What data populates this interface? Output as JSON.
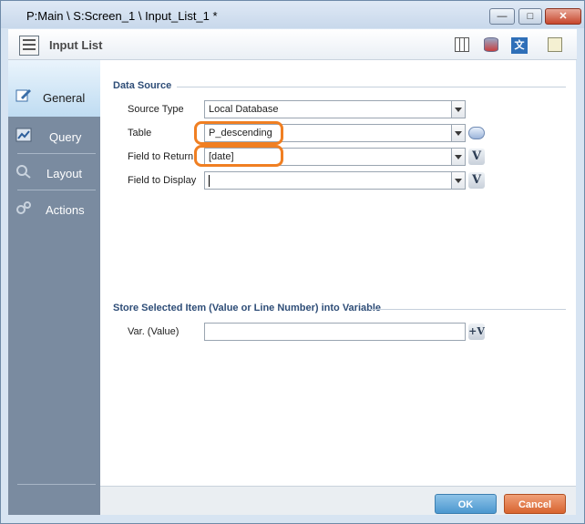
{
  "window": {
    "title": "P:Main \\ S:Screen_1 \\ Input_List_1 *",
    "min_glyph": "—",
    "max_glyph": "□",
    "close_glyph": "✕"
  },
  "toolbar": {
    "title": "Input List",
    "lang_glyph": "文"
  },
  "sidebar": {
    "items": [
      {
        "label": "General",
        "active": true,
        "icon": "pencil-icon"
      },
      {
        "label": "Query",
        "active": false,
        "icon": "chart-icon"
      },
      {
        "label": "Layout",
        "active": false,
        "icon": "magnifier-icon"
      },
      {
        "label": "Actions",
        "active": false,
        "icon": "gears-icon"
      }
    ]
  },
  "data_source": {
    "section_title": "Data Source",
    "source_type_label": "Source Type",
    "source_type_value": "Local Database",
    "table_label": "Table",
    "table_value": "P_descending",
    "field_return_label": "Field to Return",
    "field_return_value": "[date]",
    "field_display_label": "Field to Display",
    "field_display_value": "",
    "v_glyph": "V"
  },
  "store": {
    "section_title": "Store Selected Item (Value or Line Number) into Variable",
    "var_label": "Var. (Value)",
    "var_value": "",
    "v_glyph": "+V"
  },
  "footer": {
    "ok_label": "OK",
    "cancel_label": "Cancel"
  },
  "colors": {
    "highlight": "#f07f22",
    "ok_button": "#4b97cf",
    "cancel_button": "#d8632f",
    "sidebar": "#7a8ba0"
  }
}
